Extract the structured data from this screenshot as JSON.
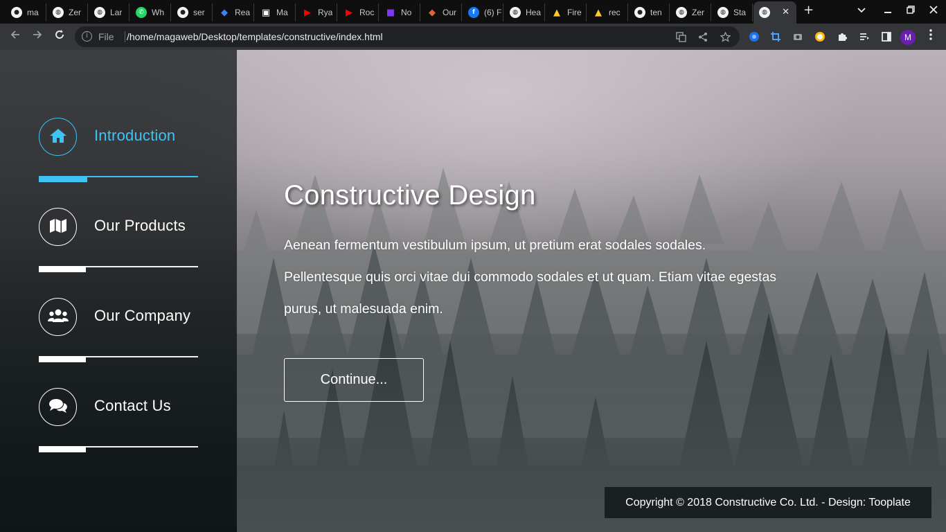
{
  "browser": {
    "tabs": [
      {
        "label": "ma",
        "icon": "github-icon",
        "color": "#ffffff"
      },
      {
        "label": "Zer",
        "icon": "globe-icon",
        "color": "#ffffff"
      },
      {
        "label": "Lar",
        "icon": "globe-icon",
        "color": "#ffffff"
      },
      {
        "label": "Wh",
        "icon": "whatsapp-icon",
        "color": "#25d366"
      },
      {
        "label": "ser",
        "icon": "github-icon",
        "color": "#ffffff"
      },
      {
        "label": "Rea",
        "icon": "react-icon",
        "color": "#3b82f6"
      },
      {
        "label": "Ma",
        "icon": "material-icon",
        "color": "#ffffff"
      },
      {
        "label": "Rya",
        "icon": "youtube-icon",
        "color": "#ff0000"
      },
      {
        "label": "Roc",
        "icon": "youtube-icon",
        "color": "#ff0000"
      },
      {
        "label": "No",
        "icon": "square-icon",
        "color": "#7c3aed"
      },
      {
        "label": "Our",
        "icon": "diamond-icon",
        "color": "#e0623a"
      },
      {
        "label": "(6) F",
        "icon": "facebook-icon",
        "color": "#1877f2"
      },
      {
        "label": "Hea",
        "icon": "globe-icon",
        "color": "#ffffff"
      },
      {
        "label": "Fire",
        "icon": "firebase-icon",
        "color": "#ffca28"
      },
      {
        "label": "rec",
        "icon": "firebase-icon",
        "color": "#ffca28"
      },
      {
        "label": "ten",
        "icon": "github-icon",
        "color": "#ffffff"
      },
      {
        "label": "Zer",
        "icon": "globe-icon",
        "color": "#ffffff"
      },
      {
        "label": "Sta",
        "icon": "globe-icon",
        "color": "#ffffff"
      },
      {
        "label": "",
        "icon": "globe-icon",
        "color": "#ffffff",
        "active": true
      }
    ],
    "close_tab": "✕",
    "new_tab": "+",
    "address": {
      "scheme_label": "File",
      "url": "/home/magaweb/Desktop/templates/constructive/index.html"
    },
    "profile_initial": "M"
  },
  "sidebar": {
    "items": [
      {
        "label": "Introduction",
        "icon": "home-icon",
        "active": true
      },
      {
        "label": "Our Products",
        "icon": "map-icon",
        "active": false
      },
      {
        "label": "Our Company",
        "icon": "users-icon",
        "active": false
      },
      {
        "label": "Contact Us",
        "icon": "comments-icon",
        "active": false
      }
    ]
  },
  "hero": {
    "title": "Constructive Design",
    "text": "Aenean fermentum vestibulum ipsum, ut pretium erat sodales sodales. Pellentesque quis orci vitae dui commodo sodales et ut quam. Etiam vitae egestas purus, ut malesuada enim.",
    "button_label": "Continue..."
  },
  "footer": {
    "copyright": "Copyright © 2018 Constructive Co. Ltd. - Design: Tooplate"
  },
  "colors": {
    "accent": "#3fc3f2",
    "sidebar_bg": "#0c1012",
    "text": "#ffffff"
  }
}
